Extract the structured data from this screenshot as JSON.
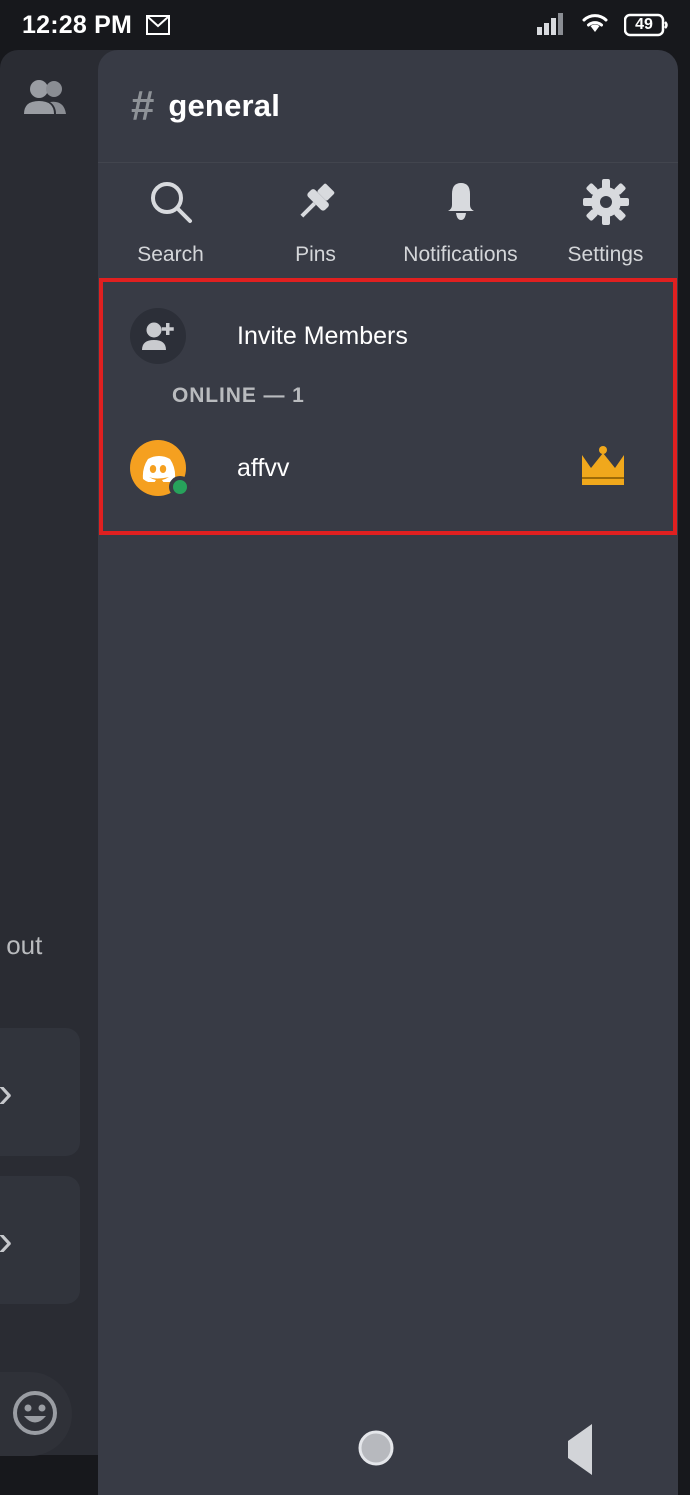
{
  "status_bar": {
    "time": "12:28 PM",
    "gmail_icon": "gmail-icon",
    "signal_icon": "cellular-signal-icon",
    "wifi_icon": "wifi-icon",
    "battery_level": "49"
  },
  "background_panel": {
    "members_icon": "people-icon",
    "partial_text": "k out",
    "chevron_icon": "chevron-right-icon",
    "emoji_icon": "emoji-smiley-icon"
  },
  "channel": {
    "hash": "#",
    "name": "general"
  },
  "actions": [
    {
      "label": "Search",
      "icon": "search-icon"
    },
    {
      "label": "Pins",
      "icon": "pin-icon"
    },
    {
      "label": "Notifications",
      "icon": "bell-icon"
    },
    {
      "label": "Settings",
      "icon": "gear-icon"
    }
  ],
  "members_panel": {
    "invite": {
      "label": "Invite Members",
      "icon": "person-add-icon"
    },
    "section_header": "ONLINE — 1",
    "members": [
      {
        "name": "affvv",
        "avatar_icon": "discord-clyde-logo",
        "avatar_color": "#F5A020",
        "presence": "online",
        "presence_color": "#27A25B",
        "badge_icon": "crown-icon",
        "badge_color": "#F0A81C"
      }
    ],
    "highlight_color": "#E02020"
  },
  "nav_bar": {
    "recents_icon": "square-recents-icon",
    "home_icon": "circle-home-icon",
    "back_icon": "triangle-back-icon"
  }
}
